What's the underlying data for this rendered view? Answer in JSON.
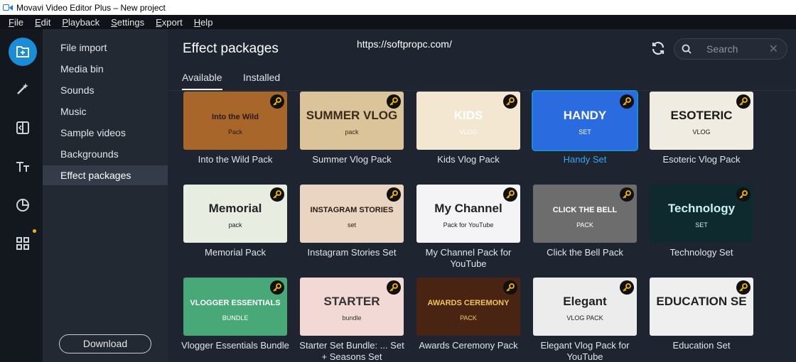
{
  "window": {
    "title": "Movavi Video Editor Plus – New project"
  },
  "menu": [
    "File",
    "Edit",
    "Playback",
    "Settings",
    "Export",
    "Help"
  ],
  "rail": {
    "icons": [
      "import-icon",
      "magic-wand-icon",
      "transitions-icon",
      "titles-icon",
      "stickers-icon",
      "more-tools-icon"
    ]
  },
  "sidebar": {
    "items": [
      "File import",
      "Media bin",
      "Sounds",
      "Music",
      "Sample videos",
      "Backgrounds",
      "Effect packages"
    ],
    "active": "Effect packages",
    "download_label": "Download"
  },
  "main": {
    "title": "Effect packages",
    "watermark": "https://softpropc.com/",
    "search_placeholder": "Search",
    "tabs": [
      "Available",
      "Installed"
    ],
    "active_tab": "Available"
  },
  "packs": [
    {
      "label": "Into the Wild Pack",
      "thumb_text": "Into the Wild",
      "thumb_sub": "Pack",
      "bg": "#a8662b",
      "fg": "#2a1a0a"
    },
    {
      "label": "Summer Vlog Pack",
      "thumb_text": "SUMMER VLOG",
      "thumb_sub": "pack",
      "bg": "#dcc49a",
      "fg": "#3a2a1a"
    },
    {
      "label": "Kids Vlog Pack",
      "thumb_text": "KIDS",
      "thumb_sub": "VLOG",
      "bg": "#f4e7d2",
      "fg": "#ffffff"
    },
    {
      "label": "Handy Set",
      "thumb_text": "HANDY",
      "thumb_sub": "SET",
      "bg": "#2b6be0",
      "fg": "#ffffff",
      "selected": true
    },
    {
      "label": "Esoteric Vlog Pack",
      "thumb_text": "ESOTERIC",
      "thumb_sub": "VLOG",
      "bg": "#f1ece2",
      "fg": "#1a1a1a"
    },
    {
      "label": "Memorial Pack",
      "thumb_text": "Memorial",
      "thumb_sub": "pack",
      "bg": "#e7ede0",
      "fg": "#222222"
    },
    {
      "label": "Instagram Stories Set",
      "thumb_text": "INSTAGRAM STORIES",
      "thumb_sub": "set",
      "bg": "#ead5c3",
      "fg": "#2a1a10"
    },
    {
      "label": "My Channel Pack for YouTube",
      "thumb_text": "My Channel",
      "thumb_sub": "Pack for YouTube",
      "bg": "#f4f4f6",
      "fg": "#222222"
    },
    {
      "label": "Click the Bell Pack",
      "thumb_text": "CLICK THE BELL",
      "thumb_sub": "PACK",
      "bg": "#6d6d6d",
      "fg": "#ffffff"
    },
    {
      "label": "Technology Set",
      "thumb_text": "Technology",
      "thumb_sub": "SET",
      "bg": "#0f2a2e",
      "fg": "#c8f2f0"
    },
    {
      "label": "Vlogger Essentials Bundle",
      "thumb_text": "VLOGGER ESSENTIALS",
      "thumb_sub": "BUNDLE",
      "bg": "#49a877",
      "fg": "#ffffff"
    },
    {
      "label": "Starter Set Bundle: ... Set + Seasons Set",
      "thumb_text": "STARTER",
      "thumb_sub": "bundle",
      "bg": "#f2d9d6",
      "fg": "#333333"
    },
    {
      "label": "Awards Ceremony Pack",
      "thumb_text": "AWARDS CEREMONY",
      "thumb_sub": "PACK",
      "bg": "#4a2413",
      "fg": "#f0c35a"
    },
    {
      "label": "Elegant Vlog Pack for YouTube",
      "thumb_text": "Elegant",
      "thumb_sub": "VLOG PACK",
      "bg": "#ececec",
      "fg": "#222222"
    },
    {
      "label": "Education Set",
      "thumb_text": "EDUCATION SE",
      "thumb_sub": "",
      "bg": "#efefef",
      "fg": "#222222"
    }
  ]
}
